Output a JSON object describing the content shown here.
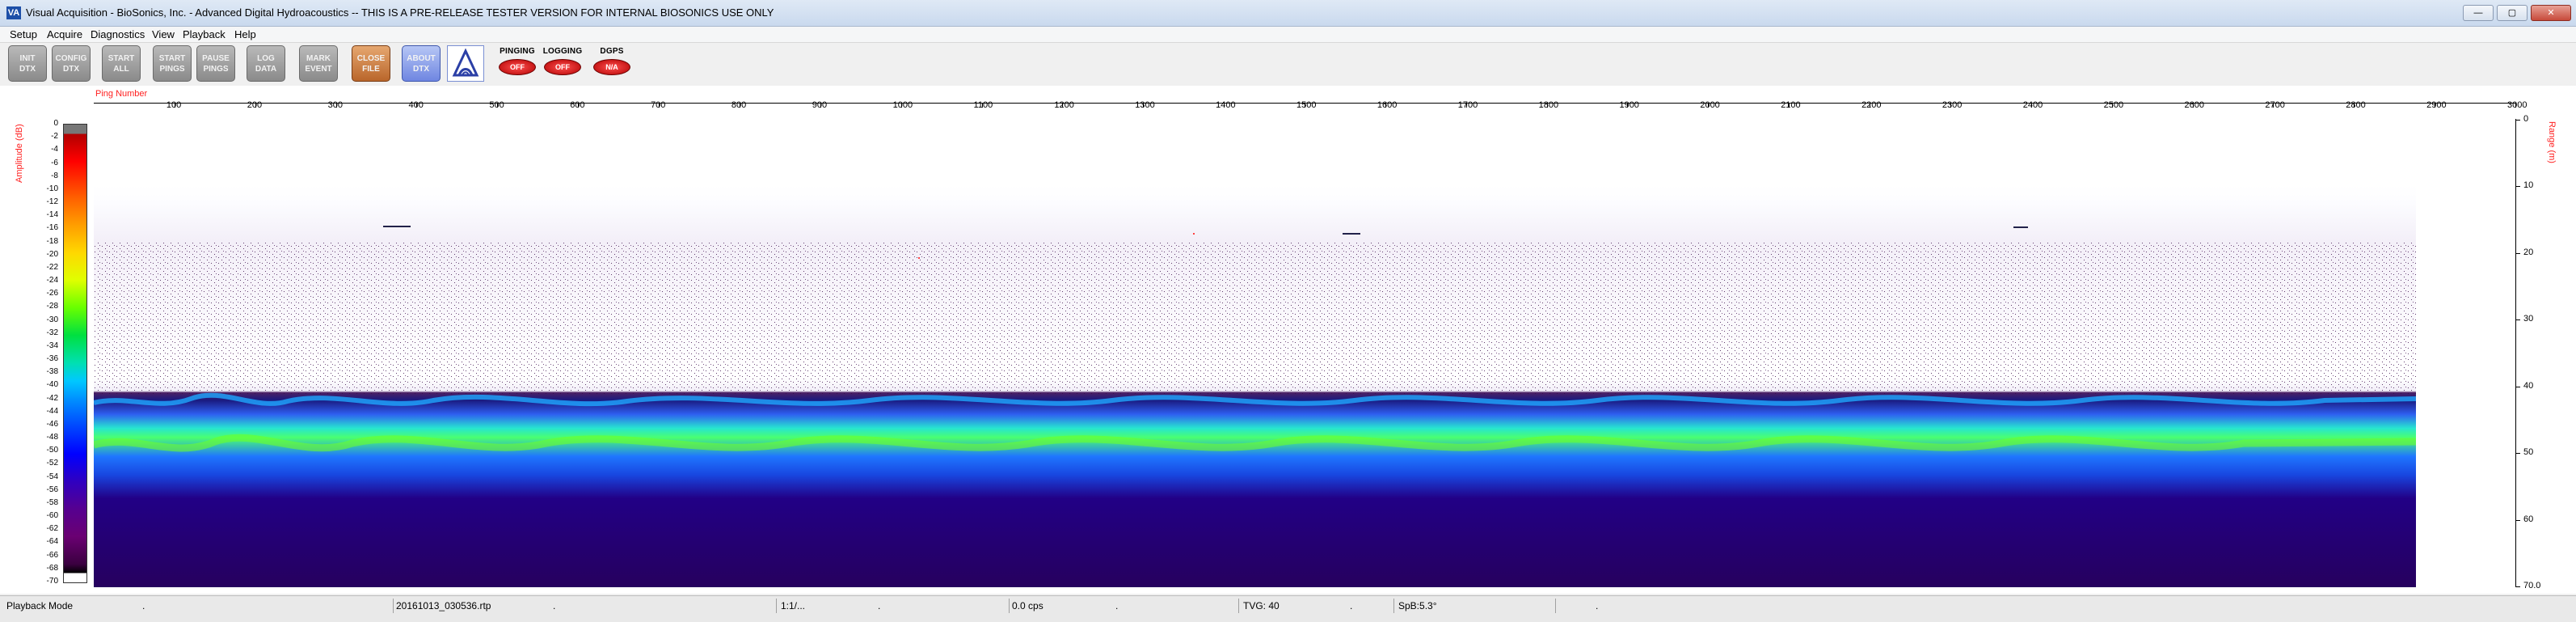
{
  "window": {
    "title": "Visual Acquisition  -  BioSonics, Inc.  -  Advanced Digital Hydroacoustics  -- THIS IS A PRE-RELEASE TESTER VERSION FOR INTERNAL BIOSONICS USE ONLY",
    "icon": "app-logo-icon",
    "minimize": "—",
    "maximize": "▢",
    "close": "✕"
  },
  "menu": [
    "Setup",
    "Acquire",
    "Diagnostics",
    "View",
    "Playback",
    "Help"
  ],
  "toolbar": {
    "buttons": [
      {
        "label": "INIT\nDTX"
      },
      {
        "label": "CONFIG\nDTX"
      },
      {
        "label": "START\nALL"
      },
      {
        "label": "START\nPINGS"
      },
      {
        "label": "PAUSE\nPINGS"
      },
      {
        "label": "LOG\nDATA"
      },
      {
        "label": "MARK\nEVENT"
      },
      {
        "label": "CLOSE\nFILE"
      },
      {
        "label": "ABOUT\nDTX"
      }
    ],
    "indicators": [
      {
        "label": "PINGING",
        "value": "OFF"
      },
      {
        "label": "LOGGING",
        "value": "OFF"
      },
      {
        "label": "DGPS",
        "value": "N/A"
      }
    ],
    "logo_icon": "biosonics-logo-icon"
  },
  "plot": {
    "left_axis_label": "Amplitude (dB)",
    "right_axis_label": "Range (m)",
    "x_axis_label": "Ping Number",
    "colorbar_ticks": [
      "0",
      "-2",
      "-4",
      "-6",
      "-8",
      "-10",
      "-12",
      "-14",
      "-16",
      "-18",
      "-20",
      "-22",
      "-24",
      "-26",
      "-28",
      "-30",
      "-32",
      "-34",
      "-36",
      "-38",
      "-40",
      "-42",
      "-44",
      "-46",
      "-48",
      "-50",
      "-52",
      "-54",
      "-56",
      "-58",
      "-60",
      "-62",
      "-64",
      "-66",
      "-68",
      "-70"
    ],
    "ping_ticks": [
      "100",
      "200",
      "300",
      "400",
      "500",
      "600",
      "700",
      "800",
      "900",
      "1000",
      "1100",
      "1200",
      "1300",
      "1400",
      "1500",
      "1600",
      "1700",
      "1800",
      "1900",
      "2000",
      "2100",
      "2200",
      "2300",
      "2400",
      "2500",
      "2600",
      "2700",
      "2800",
      "2900",
      "3000"
    ],
    "range_ticks": [
      "0",
      "10",
      "20",
      "30",
      "40",
      "50",
      "60",
      "70.0"
    ],
    "colorbar_colors": [
      "#777777",
      "#ff0000",
      "#ffd800",
      "#00e040",
      "#00c8ff",
      "#0000ff",
      "#560090",
      "#000000"
    ],
    "bottom_echo_range_m": 42,
    "x_range": [
      0,
      3000
    ],
    "range_m": [
      0,
      70
    ]
  },
  "status": {
    "mode": "Playback Mode",
    "dot1": ".",
    "file": "20161013_030536.rtp",
    "dot2": ".",
    "page": "1:1/...",
    "dot3": ".",
    "rate": "0.0 cps",
    "dot4": ".",
    "tvg": "TVG: 40",
    "dot5": ".",
    "sp": "SpB:5.3°",
    "dot6": "."
  }
}
